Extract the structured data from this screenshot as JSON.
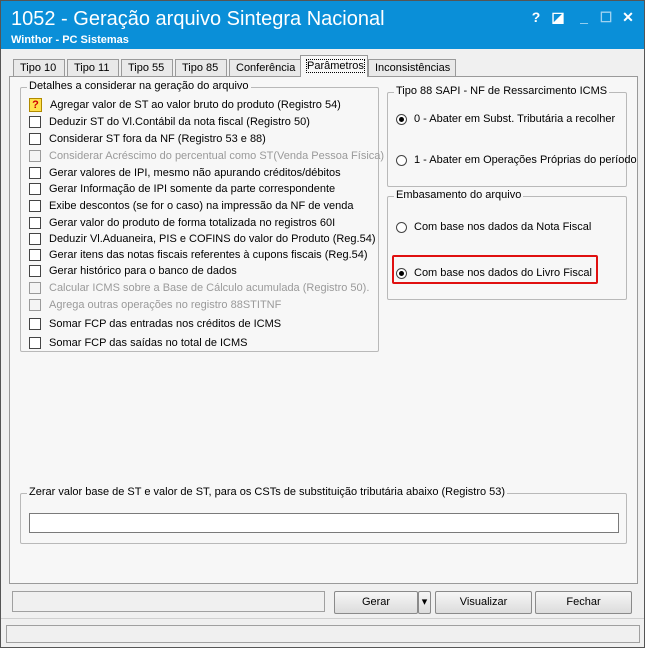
{
  "window": {
    "title": "1052 - Geração arquivo Sintegra Nacional",
    "subtitle": "Winthor - PC Sistemas",
    "controls": {
      "help": "?",
      "restore": "◪",
      "minimize": "_",
      "maximize": "☐",
      "close": "✕"
    }
  },
  "tabs": [
    {
      "label": "Tipo 10",
      "active": false
    },
    {
      "label": "Tipo 11",
      "active": false
    },
    {
      "label": "Tipo 55",
      "active": false
    },
    {
      "label": "Tipo 85",
      "active": false
    },
    {
      "label": "Conferência",
      "active": false
    },
    {
      "label": "Parâmetros",
      "active": true
    },
    {
      "label": "Inconsistências",
      "active": false
    }
  ],
  "details": {
    "legend": "Detalhes a considerar na geração do arquivo",
    "items": [
      {
        "label": "Agregar valor de ST ao valor bruto do produto (Registro 54)",
        "icon": "question-icon"
      },
      {
        "label": "Deduzir ST do Vl.Contábil da nota fiscal (Registro 50)"
      },
      {
        "label": "Considerar ST fora da NF (Registro 53 e 88)"
      },
      {
        "label": "Considerar Acréscimo do percentual como ST(Venda Pessoa Física)",
        "disabled": true
      },
      {
        "label": "Gerar valores de IPI, mesmo não apurando créditos/débitos"
      },
      {
        "label": "Gerar Informação de IPI somente da parte correspondente"
      },
      {
        "label": "Exibe descontos (se for o caso) na impressão da NF de venda"
      },
      {
        "label": "Gerar valor do produto de forma totalizada no registros 60I"
      },
      {
        "label": "Deduzir Vl.Aduaneira, PIS e COFINS do valor do Produto (Reg.54)"
      },
      {
        "label": "Gerar itens das notas fiscais referentes à cupons fiscais (Reg.54)"
      },
      {
        "label": "Gerar histórico para o banco de dados"
      },
      {
        "label": "Calcular ICMS sobre a Base de Cálculo acumulada (Registro 50).",
        "disabled": true
      },
      {
        "label": "Agrega outras operações no registro 88STITNF",
        "disabled": true
      },
      {
        "label": "Somar FCP das entradas nos créditos de ICMS"
      },
      {
        "label": "Somar FCP das saídas no total de ICMS"
      }
    ]
  },
  "tipo88": {
    "legend": "Tipo 88  SAPI - NF de Ressarcimento ICMS",
    "options": [
      {
        "label": "0 - Abater em Subst. Tributária a recolher",
        "checked": true
      },
      {
        "label": "1 - Abater em Operações Próprias do período",
        "checked": false
      }
    ]
  },
  "embasamento": {
    "legend": "Embasamento do arquivo",
    "options": [
      {
        "label": "Com base nos dados da Nota Fiscal",
        "checked": false
      },
      {
        "label": "Com base nos dados do Livro Fiscal",
        "checked": true
      }
    ]
  },
  "zerar": {
    "legend": "Zerar valor base de ST e valor de ST, para os CSTs de substituição tributária abaixo (Registro 53)",
    "value": ""
  },
  "buttons": {
    "gerar": "Gerar",
    "gerar_dropdown": "▾",
    "visualizar": "Visualizar",
    "fechar": "Fechar"
  },
  "colors": {
    "titlebar": "#0a8fd8",
    "highlight": "#e01010"
  }
}
